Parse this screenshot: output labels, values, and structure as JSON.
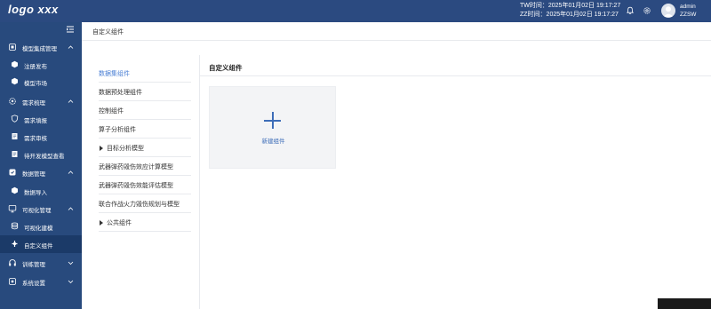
{
  "header": {
    "logo": "logo xxx",
    "tw_time": "TW时间：2025年01月02日 19:17:27",
    "zz_time": "ZZ时间：2025年01月02日 19:17:27",
    "user_name": "admin",
    "user_org": "ZZSW"
  },
  "sidebar": {
    "groups": [
      {
        "label": "模型集成管理",
        "icon": "cube-stack-icon",
        "items": [
          {
            "label": "注册发布",
            "icon": "cube-icon"
          },
          {
            "label": "模型市场",
            "icon": "cube-icon"
          }
        ]
      },
      {
        "label": "需求梳理",
        "icon": "gear-icon",
        "items": [
          {
            "label": "需求填报",
            "icon": "shield-icon"
          },
          {
            "label": "需求审核",
            "icon": "document-icon"
          },
          {
            "label": "待开发模型查看",
            "icon": "document-icon"
          }
        ]
      },
      {
        "label": "数据管理",
        "icon": "database-icon",
        "items": [
          {
            "label": "数据导入",
            "icon": "cube-icon"
          }
        ]
      },
      {
        "label": "可视化管理",
        "icon": "monitor-icon",
        "items": [
          {
            "label": "可视化建模",
            "icon": "layers-icon"
          },
          {
            "label": "自定义组件",
            "icon": "plugin-icon"
          }
        ]
      },
      {
        "label": "训练管理",
        "icon": "headset-icon",
        "items": []
      },
      {
        "label": "系统设置",
        "icon": "settings-icon",
        "items": []
      }
    ],
    "active_item": "自定义组件"
  },
  "breadcrumb": "自定义组件",
  "component_list": [
    {
      "label": "数据集组件",
      "selected": true,
      "expandable": false
    },
    {
      "label": "数据预处理组件",
      "selected": false,
      "expandable": false
    },
    {
      "label": "控制组件",
      "selected": false,
      "expandable": false
    },
    {
      "label": "算子分析组件",
      "selected": false,
      "expandable": false
    },
    {
      "label": "目标分析模型",
      "selected": false,
      "expandable": true
    },
    {
      "label": "武器弹药毁伤效应计算模型",
      "selected": false,
      "expandable": false
    },
    {
      "label": "武器弹药毁伤效能评估模型",
      "selected": false,
      "expandable": false
    },
    {
      "label": "联合作战火力毁伤规划与模型",
      "selected": false,
      "expandable": false
    },
    {
      "label": "公共组件",
      "selected": false,
      "expandable": true
    }
  ],
  "section_title": "自定义组件",
  "new_component_label": "新建组件",
  "colors": {
    "header": "#2b4a80",
    "sidebar": "#284a7d",
    "active_item": "#1b3a68",
    "accent": "#3d6db8"
  }
}
